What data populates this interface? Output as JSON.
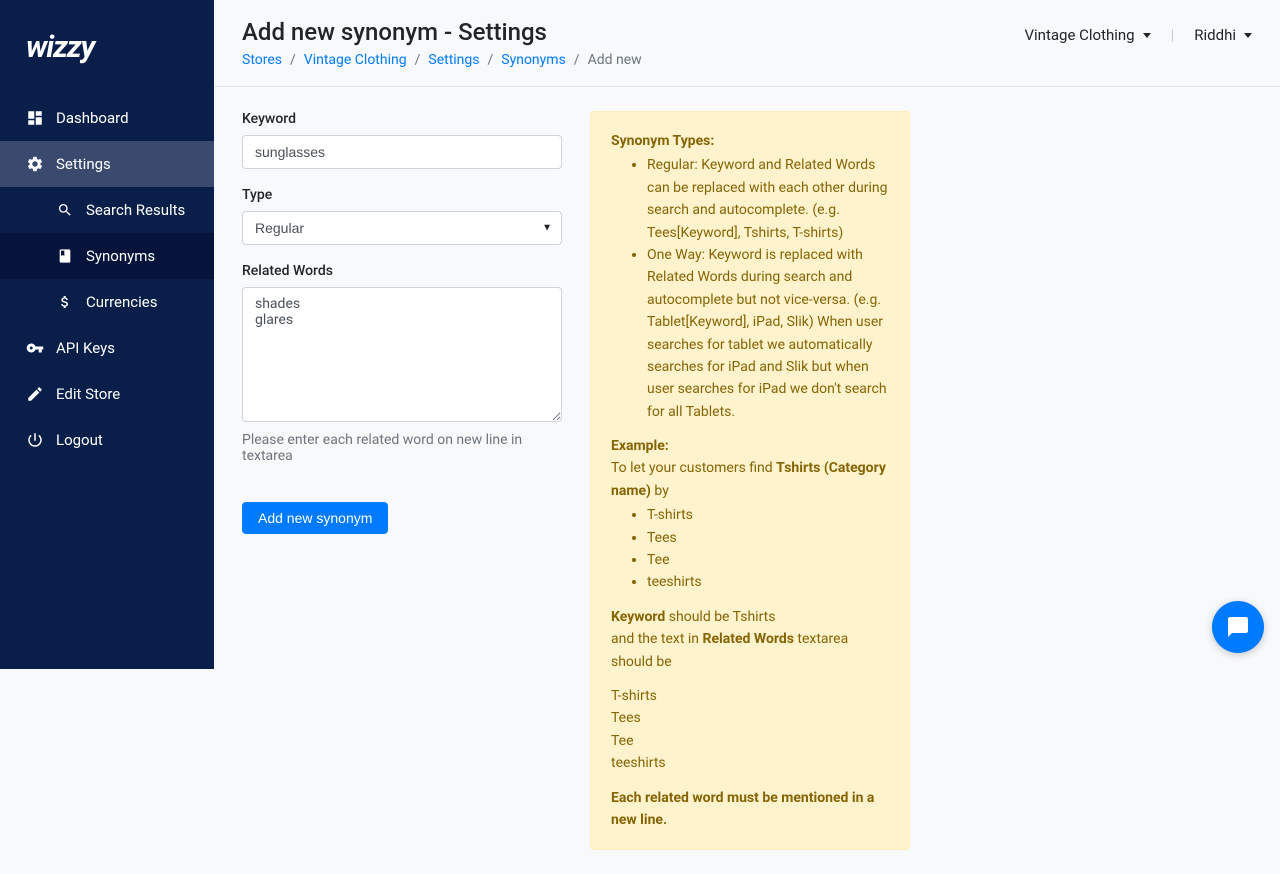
{
  "logo": "wizzy",
  "sidebar": {
    "dashboard": "Dashboard",
    "settings": "Settings",
    "search_results": "Search Results",
    "synonyms": "Synonyms",
    "currencies": "Currencies",
    "api_keys": "API Keys",
    "edit_store": "Edit Store",
    "logout": "Logout"
  },
  "header": {
    "title": "Add new synonym - Settings",
    "store_dropdown": "Vintage Clothing",
    "user_dropdown": "Riddhi"
  },
  "breadcrumb": {
    "stores": "Stores",
    "store_name": "Vintage Clothing",
    "settings": "Settings",
    "synonyms": "Synonyms",
    "current": "Add new"
  },
  "form": {
    "keyword_label": "Keyword",
    "keyword_value": "sunglasses",
    "type_label": "Type",
    "type_value": "Regular",
    "related_label": "Related Words",
    "related_value": "shades\nglares",
    "related_help": "Please enter each related word on new line in textarea",
    "submit": "Add new synonym"
  },
  "help": {
    "types_heading": "Synonym Types:",
    "type_regular": "Regular: Keyword and Related Words can be replaced with each other during search and autocomplete. (e.g. Tees[Keyword], Tshirts, T-shirts)",
    "type_oneway": "One Way: Keyword is replaced with Related Words during search and autocomplete but not vice-versa. (e.g. Tablet[Keyword], iPad, Slik) When user searches for tablet we automatically searches for iPad and Slik but when user searches for iPad we don't search for all Tablets.",
    "example_heading": "Example:",
    "example_intro_1": "To let your customers find ",
    "example_intro_bold": "Tshirts (Category name)",
    "example_intro_2": " by",
    "example_items": {
      "a": "T-shirts",
      "b": "Tees",
      "c": "Tee",
      "d": "teeshirts"
    },
    "keyword_bold": "Keyword",
    "keyword_text": " should be Tshirts",
    "related_text_1": "and the text in ",
    "related_bold": "Related Words",
    "related_text_2": " textarea should be",
    "example_lines": {
      "a": "T-shirts",
      "b": "Tees",
      "c": "Tee",
      "d": "teeshirts"
    },
    "footer_note": "Each related word must be mentioned in a new line."
  }
}
